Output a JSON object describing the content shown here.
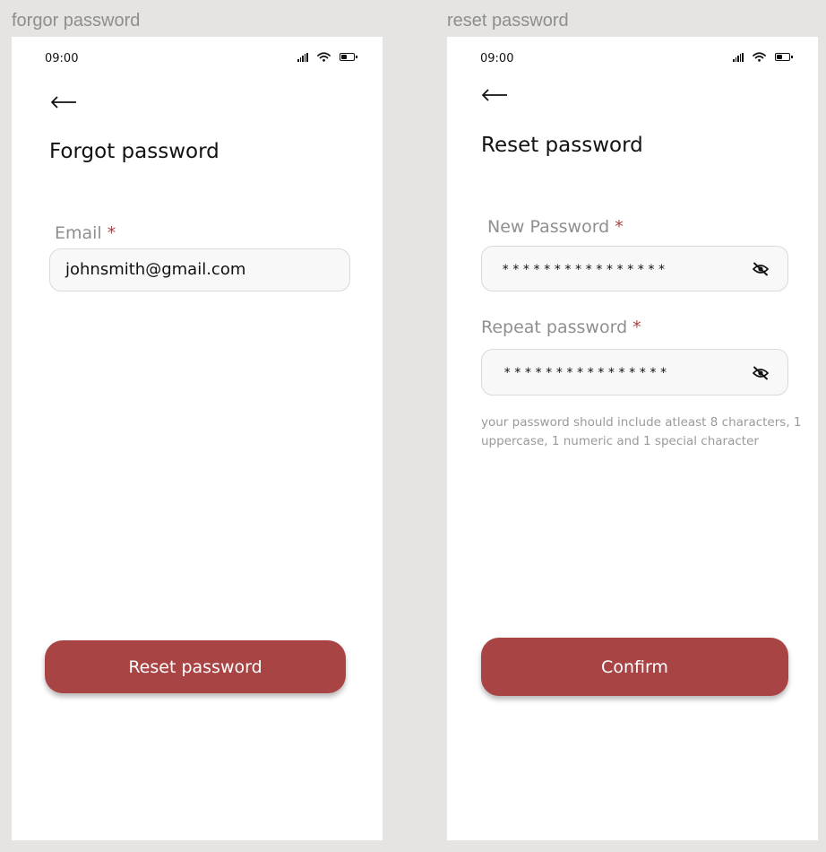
{
  "frames": {
    "forgot": {
      "frame_label": "forgor password",
      "status_time": "09:00",
      "title": "Forgot password",
      "email_label": "Email",
      "required_mark": "*",
      "email_value": "johnsmith@gmail.com",
      "button_label": "Reset password"
    },
    "reset": {
      "frame_label": "reset password",
      "status_time": "09:00",
      "title": "Reset password",
      "new_password_label": "New Password",
      "repeat_password_label": "Repeat password",
      "required_mark": "*",
      "new_password_mask": "****************",
      "repeat_password_mask": "****************",
      "hint": "your password should include atleast 8 characters, 1 uppercase, 1 numeric and 1 special character",
      "button_label": "Confirm"
    }
  },
  "icons": {
    "back": "arrow-left-icon",
    "signal": "cellular-signal-icon",
    "wifi": "wifi-icon",
    "battery": "battery-icon",
    "eye": "eye-off-icon"
  },
  "colors": {
    "accent": "#a84444",
    "canvas": "#e5e4e2",
    "input_bg": "#f8f8f8",
    "label_gray": "#8f8f8f"
  }
}
